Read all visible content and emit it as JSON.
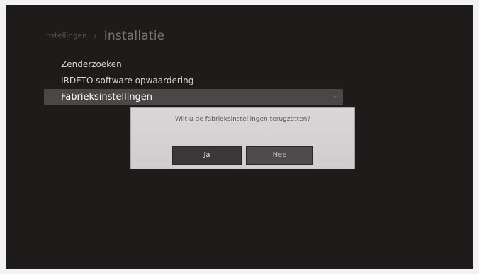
{
  "breadcrumb": {
    "parent": "Instellingen",
    "separator": "›",
    "current": "Installatie"
  },
  "menu": {
    "items": [
      {
        "label": "Zenderzoeken"
      },
      {
        "label": "IRDETO software opwaardering"
      },
      {
        "label": "Fabrieksinstellingen",
        "selected": true
      }
    ]
  },
  "dialog": {
    "message": "Wilt u de fabrieksinstellingen terugzetten?",
    "yes_label": "Ja",
    "no_label": "Nee"
  }
}
